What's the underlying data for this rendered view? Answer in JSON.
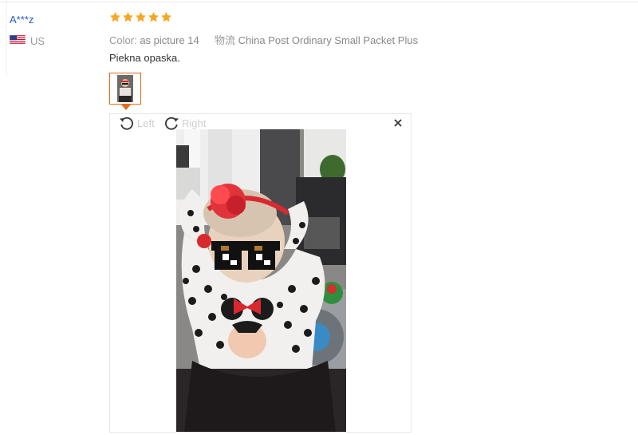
{
  "review": {
    "user": "A***z",
    "country": "US",
    "rating": 5,
    "color_label": "Color:",
    "color_value": "as picture 14",
    "shipping_label": "物流",
    "shipping_value": "China Post Ordinary Small Packet Plus",
    "text": "Piekna opaska."
  },
  "viewer": {
    "rotate_left_label": "Left",
    "rotate_right_label": "Right"
  },
  "icons": {
    "flag": "us-flag-icon",
    "star": "star-icon",
    "rotate_left": "rotate-left-icon",
    "rotate_right": "rotate-right-icon",
    "close": "close-icon"
  },
  "colors": {
    "user_name": "#2a5ab8",
    "star": "#f5a623",
    "thumb_border": "#e56a1b",
    "muted_text": "#999999"
  }
}
